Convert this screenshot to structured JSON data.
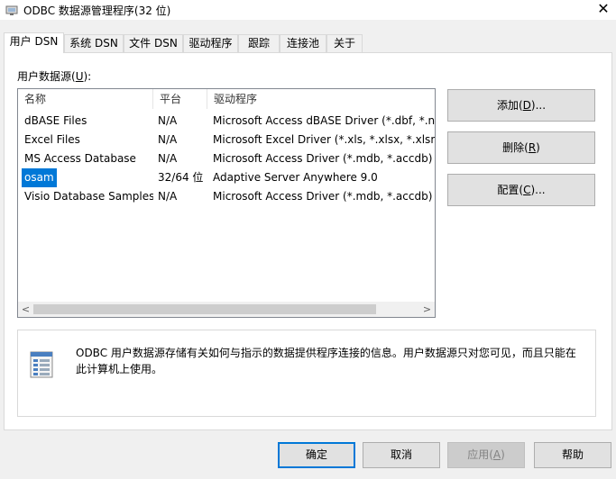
{
  "window": {
    "title": "ODBC 数据源管理程序(32 位)",
    "close_glyph": "✕"
  },
  "tabs": [
    {
      "label": "用户 DSN",
      "active": true
    },
    {
      "label": "系统 DSN",
      "active": false
    },
    {
      "label": "文件 DSN",
      "active": false
    },
    {
      "label": "驱动程序",
      "active": false
    },
    {
      "label": "跟踪",
      "active": false
    },
    {
      "label": "连接池",
      "active": false
    },
    {
      "label": "关于",
      "active": false
    }
  ],
  "user_dsn": {
    "list_label_prefix": "用户数据源(",
    "list_label_key": "U",
    "list_label_suffix": "):",
    "columns": [
      "名称",
      "平台",
      "驱动程序"
    ],
    "rows": [
      {
        "name": "dBASE Files",
        "platform": "N/A",
        "driver": "Microsoft Access dBASE Driver (*.dbf, *.nd"
      },
      {
        "name": "Excel Files",
        "platform": "N/A",
        "driver": "Microsoft Excel Driver (*.xls, *.xlsx, *.xlsm, *"
      },
      {
        "name": "MS Access Database",
        "platform": "N/A",
        "driver": "Microsoft Access Driver (*.mdb, *.accdb)"
      },
      {
        "name": "osam",
        "platform": "32/64 位",
        "driver": "Adaptive Server Anywhere 9.0",
        "selected": true
      },
      {
        "name": "Visio Database Samples",
        "platform": "N/A",
        "driver": "Microsoft Access Driver (*.mdb, *.accdb)"
      }
    ],
    "scroll_left_glyph": "<",
    "scroll_right_glyph": ">"
  },
  "side_buttons": {
    "add_prefix": "添加(",
    "add_key": "D",
    "add_suffix": ")...",
    "remove_prefix": "删除(",
    "remove_key": "R",
    "remove_suffix": ")",
    "config_prefix": "配置(",
    "config_key": "C",
    "config_suffix": ")..."
  },
  "info": {
    "icon": "data-source-icon",
    "text": "ODBC 用户数据源存储有关如何与指示的数据提供程序连接的信息。用户数据源只对您可见，而且只能在此计算机上使用。"
  },
  "dialog_buttons": {
    "ok": "确定",
    "cancel": "取消",
    "apply_prefix": "应用(",
    "apply_key": "A",
    "apply_suffix": ")",
    "help": "帮助"
  },
  "colors": {
    "selection": "#0078d7",
    "default_button_border": "#0078d7"
  }
}
